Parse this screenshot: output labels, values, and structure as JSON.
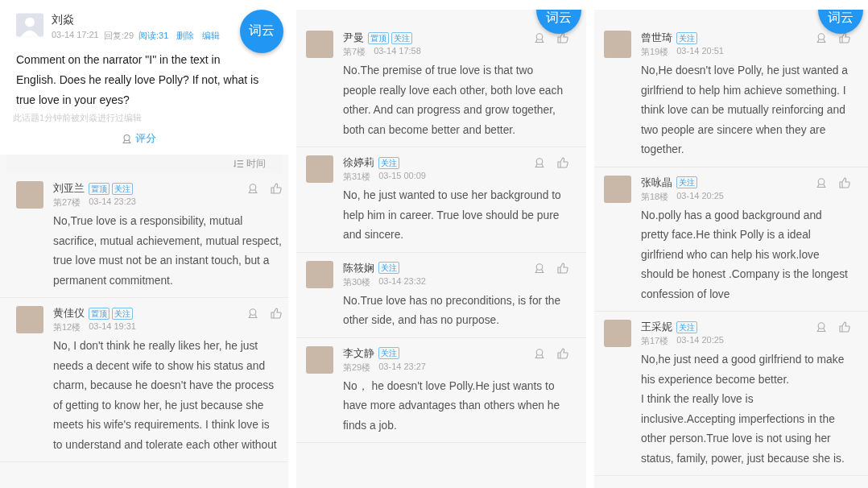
{
  "panels": [
    {
      "word_cloud_button": "词云",
      "post": {
        "author": "刘焱",
        "time": "03-14 17:21",
        "replies": "回复:29",
        "reads": "阅读:31",
        "actions": [
          "删除",
          "编辑"
        ],
        "question": "Comment on the narrator \"I\" in the text in English. Does he really love Polly? If not, what is true love  in your eyes?",
        "edit_note": "此话题1分钟前被刘焱进行过编辑",
        "rate_button": "评分"
      },
      "sort": {
        "label": "时间"
      },
      "comments": [
        {
          "name": "刘亚兰",
          "tags": [
            "置顶",
            "关注"
          ],
          "floor": "第27楼",
          "time": "03-14 23:23",
          "text": "No,True love is a responsibility, mutual sacrifice, mutual achievement, mutual respect, true love must not be an instant touch, but a permanent commitment."
        },
        {
          "name": "黄佳仪",
          "tags": [
            "置顶",
            "关注"
          ],
          "floor": "第12楼",
          "time": "03-14 19:31",
          "text": "No, I don't think he really likes her, he just needs a decent wife to show his status and charm, because he doesn't have the process of getting to know her, he just because she meets his wife's requirements. I think love is to understand and tolerate each other without"
        }
      ]
    },
    {
      "word_cloud_button": "词云",
      "comments": [
        {
          "name": "尹曼",
          "tags": [
            "置顶",
            "关注"
          ],
          "floor": "第7楼",
          "time": "03-14 17:58",
          "text": "No.The premise of true love is that two people really love each other, both love each other. And can progress and grow together, both can become better and better."
        },
        {
          "name": "徐婷莉",
          "tags": [
            "关注"
          ],
          "floor": "第31楼",
          "time": "03-15 00:09",
          "text": "No, he just wanted to use her background to help him in career. True love should be pure and sincere."
        },
        {
          "name": "陈筱娴",
          "tags": [
            "关注"
          ],
          "floor": "第30楼",
          "time": "03-14 23:32",
          "text": "No.True love has no preconditions, is for the other side, and has no purpose."
        },
        {
          "name": "李文静",
          "tags": [
            "关注"
          ],
          "floor": "第29楼",
          "time": "03-14 23:27",
          "text": "No， he doesn't love Polly.He just wants to have more advantages than others when he finds a job."
        }
      ]
    },
    {
      "word_cloud_button": "词云",
      "comments": [
        {
          "name": "曾世琦",
          "tags": [
            "关注"
          ],
          "floor": "第19楼",
          "time": "03-14 20:51",
          "text": "No,He doesn't love Polly, he just wanted a girlfriend to help him achieve something. I think love can be mutually reinforcing and two people are sincere when they are together."
        },
        {
          "name": "张咏晶",
          "tags": [
            "关注"
          ],
          "floor": "第18楼",
          "time": "03-14 20:25",
          "text": "No.polly has a good background and pretty face.He think Polly is a ideal girlfriend who can help his work.love should be honest .Company is the longest confession of love"
        },
        {
          "name": "王采妮",
          "tags": [
            "关注"
          ],
          "floor": "第17楼",
          "time": "03-14 20:25",
          "text": "No,he just need a good girlfriend to make his experience become better.\nI think the really love is inclusive.Accepting imperfections in the other person.True love is not using her status, family, power, just because she is."
        }
      ]
    }
  ]
}
